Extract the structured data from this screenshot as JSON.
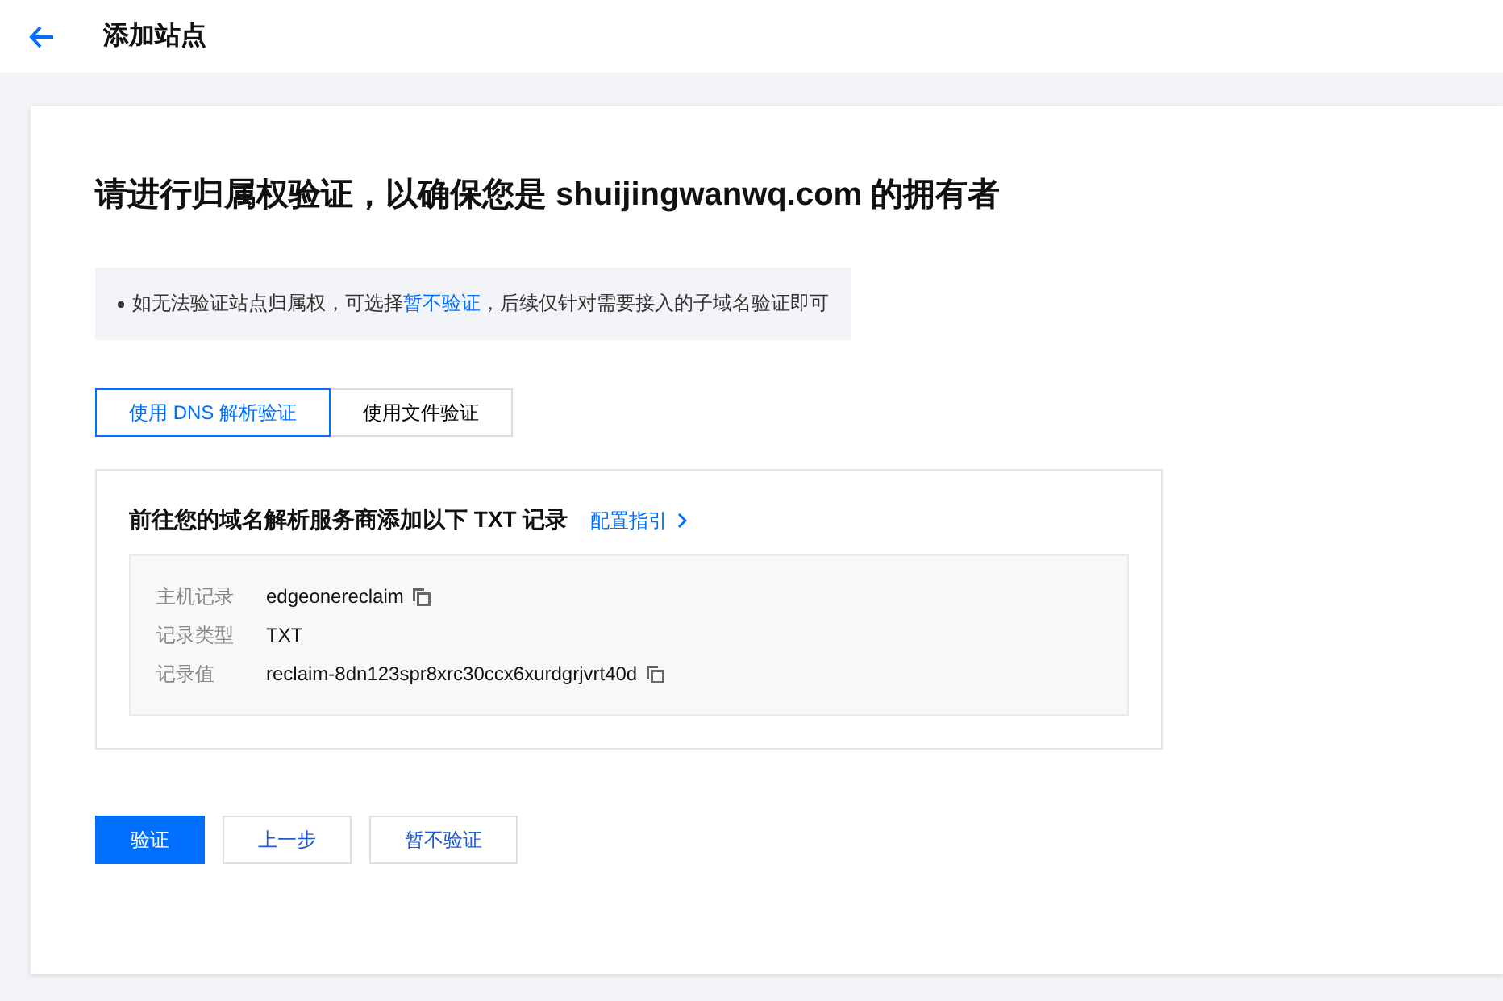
{
  "header": {
    "title": "添加站点"
  },
  "heading": "请进行归属权验证，以确保您是 shuijingwanwq.com 的拥有者",
  "notice": {
    "before": "如无法验证站点归属权，可选择",
    "link": "暂不验证",
    "after": "，后续仅针对需要接入的子域名验证即可"
  },
  "tabs": [
    {
      "label": "使用 DNS 解析验证",
      "selected": true
    },
    {
      "label": "使用文件验证",
      "selected": false
    }
  ],
  "dns_panel": {
    "title": "前往您的域名解析服务商添加以下 TXT 记录",
    "guide_link": "配置指引",
    "records": [
      {
        "label": "主机记录",
        "value": "edgeonereclaim",
        "copyable": true
      },
      {
        "label": "记录类型",
        "value": "TXT",
        "copyable": false
      },
      {
        "label": "记录值",
        "value": "reclaim-8dn123spr8xrc30ccx6xurdgrjvrt40d",
        "copyable": true
      }
    ]
  },
  "buttons": [
    {
      "label": "验证",
      "kind": "primary"
    },
    {
      "label": "上一步",
      "kind": "default"
    },
    {
      "label": "暂不验证",
      "kind": "default"
    }
  ]
}
